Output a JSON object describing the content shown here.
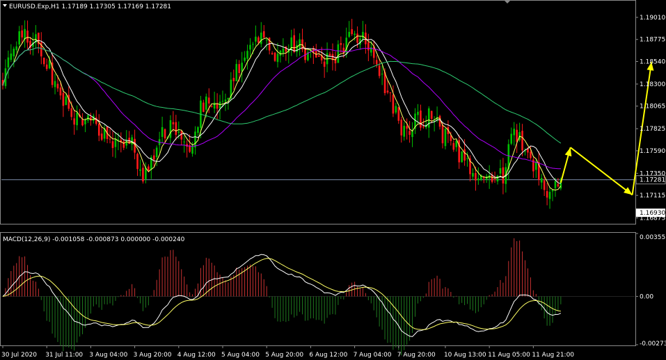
{
  "header": {
    "symbol_line": "EURUSD.Exp,H1  1.17189 1.17305 1.17169 1.17281"
  },
  "macd_header": "MACD(12,26,9) -0.001058 -0.000873 0.000000 -0.000240",
  "colors": {
    "background": "#000000",
    "bull": "#00c000",
    "bear": "#ff1a1a",
    "ma_fast": "#ffff66",
    "ma_white": "#ffffff",
    "ma_mid": "#b000ff",
    "ma_slow": "#2ecc71",
    "arrow": "#ffff00",
    "hist_pos": "#c83232",
    "hist_neg": "#1f7a1f",
    "grid": "#8a8a8a"
  },
  "chart_data": [
    {
      "type": "candlestick",
      "title": "EURUSD.Exp,H1",
      "ohlc": {
        "open": "1.17189",
        "high": "1.17305",
        "low": "1.17169",
        "close": "1.17281"
      },
      "y_ticks": [
        "1.19010",
        "1.18775",
        "1.18540",
        "1.18300",
        "1.18065",
        "1.17825",
        "1.17590",
        "1.17350",
        "1.17115",
        "1.16875"
      ],
      "ylim": [
        1.1682,
        1.1918
      ],
      "current_price": "1.17281",
      "low_marker": "1.16930",
      "x_ticks": [
        "30 Jul 2020",
        "31 Jul 11:00",
        "3 Aug 04:00",
        "3 Aug 20:00",
        "4 Aug 12:00",
        "5 Aug 04:00",
        "5 Aug 20:00",
        "6 Aug 12:00",
        "7 Aug 04:00",
        "7 Aug 20:00",
        "10 Aug 13:00",
        "11 Aug 05:00",
        "11 Aug 21:00"
      ],
      "anchors": [
        [
          0,
          1.1835
        ],
        [
          6,
          1.188
        ],
        [
          12,
          1.1875
        ],
        [
          18,
          1.184
        ],
        [
          26,
          1.179
        ],
        [
          32,
          1.1795
        ],
        [
          40,
          1.176
        ],
        [
          46,
          1.1775
        ],
        [
          50,
          1.1735
        ],
        [
          53,
          1.174
        ],
        [
          56,
          1.1766
        ],
        [
          62,
          1.179
        ],
        [
          68,
          1.176
        ],
        [
          72,
          1.1805
        ],
        [
          80,
          1.181
        ],
        [
          86,
          1.185
        ],
        [
          92,
          1.189
        ],
        [
          98,
          1.186
        ],
        [
          104,
          1.187
        ],
        [
          112,
          1.1865
        ],
        [
          120,
          1.1855
        ],
        [
          126,
          1.188
        ],
        [
          132,
          1.1875
        ],
        [
          138,
          1.184
        ],
        [
          142,
          1.1805
        ],
        [
          146,
          1.178
        ],
        [
          150,
          1.179
        ],
        [
          156,
          1.1795
        ],
        [
          160,
          1.1775
        ],
        [
          164,
          1.1765
        ],
        [
          170,
          1.174
        ],
        [
          176,
          1.173
        ],
        [
          182,
          1.1735
        ],
        [
          186,
          1.178
        ],
        [
          192,
          1.1755
        ],
        [
          196,
          1.1725
        ],
        [
          200,
          1.1715
        ],
        [
          203,
          1.1722
        ]
      ],
      "moving_averages": [
        {
          "periods": 5,
          "color_key": "ma_fast"
        },
        {
          "periods": 10,
          "color_key": "ma_white"
        },
        {
          "periods": 30,
          "color_key": "ma_mid"
        },
        {
          "periods": 70,
          "color_key": "ma_slow"
        }
      ],
      "projection_arrows": [
        {
          "from": [
            203,
            1.1725
          ],
          "to": [
            206.5,
            1.17625
          ]
        },
        {
          "from": [
            206.5,
            1.17625
          ],
          "to": [
            229,
            1.1712
          ]
        },
        {
          "from": [
            229,
            1.1712
          ],
          "to": [
            236,
            1.18535
          ]
        }
      ]
    },
    {
      "type": "line",
      "title": "MACD(12,26,9)",
      "values_text": "-0.001058 -0.000873 0.000000 -0.000240",
      "y_ticks": [
        "0.003557",
        "0.00",
        "-0.002735"
      ],
      "ylim": [
        -0.002735,
        0.003557
      ],
      "series": [
        {
          "kind": "line",
          "color_key": "ma_white"
        },
        {
          "kind": "line",
          "color_key": "ma_fast"
        },
        {
          "kind": "histogram",
          "color_key": "hist_pos"
        }
      ]
    }
  ]
}
